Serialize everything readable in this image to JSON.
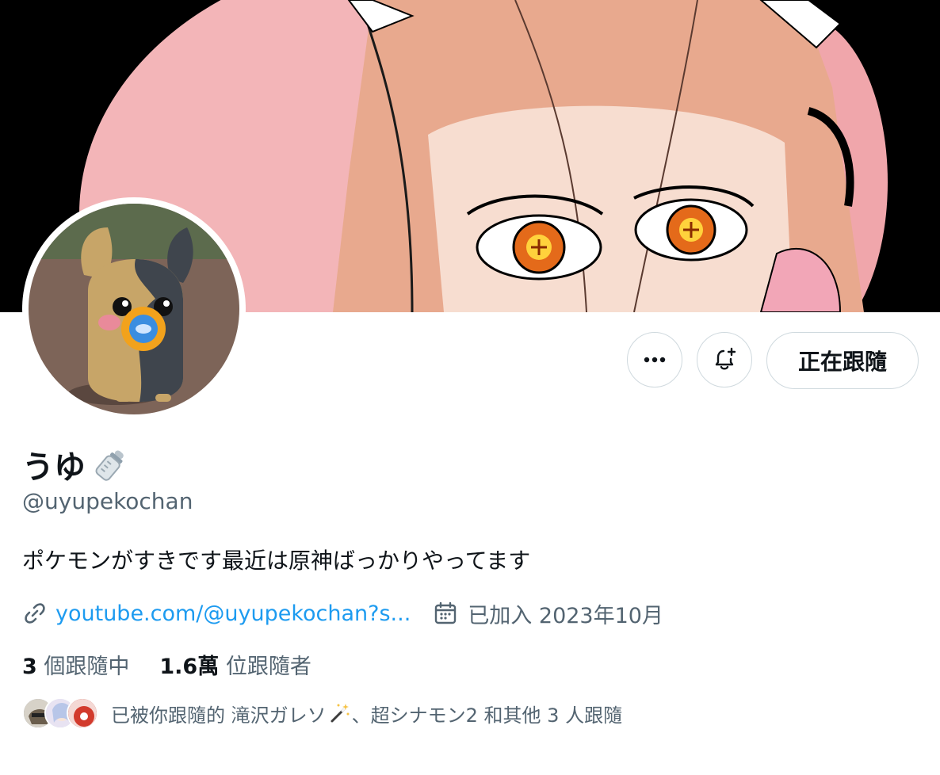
{
  "profile": {
    "display_name": "うゆ",
    "name_emoji": "baby-bottle-icon",
    "handle": "@uyupekochan",
    "bio": "ポケモンがすきです最近は原神ばっかりやってます",
    "link_text": "youtube.com/@uyupekochan?s...",
    "joined": "已加入 2023年10月"
  },
  "actions": {
    "more_icon": "more-icon",
    "notify_icon": "bell-plus-icon",
    "follow_label": "正在跟隨"
  },
  "stats": {
    "following_count": "3",
    "following_label": "個跟隨中",
    "followers_count": "1.6萬",
    "followers_label": "位跟隨者"
  },
  "followed_by": {
    "prefix": "已被你跟隨的 滝沢ガレソ",
    "emoji": "magic-wand-icon",
    "suffix": "、超シナモン2 和其他 3 人跟隨"
  },
  "colors": {
    "text": "#0f1419",
    "secondary": "#536471",
    "link": "#1d9bf0",
    "border": "#cfd9de"
  }
}
